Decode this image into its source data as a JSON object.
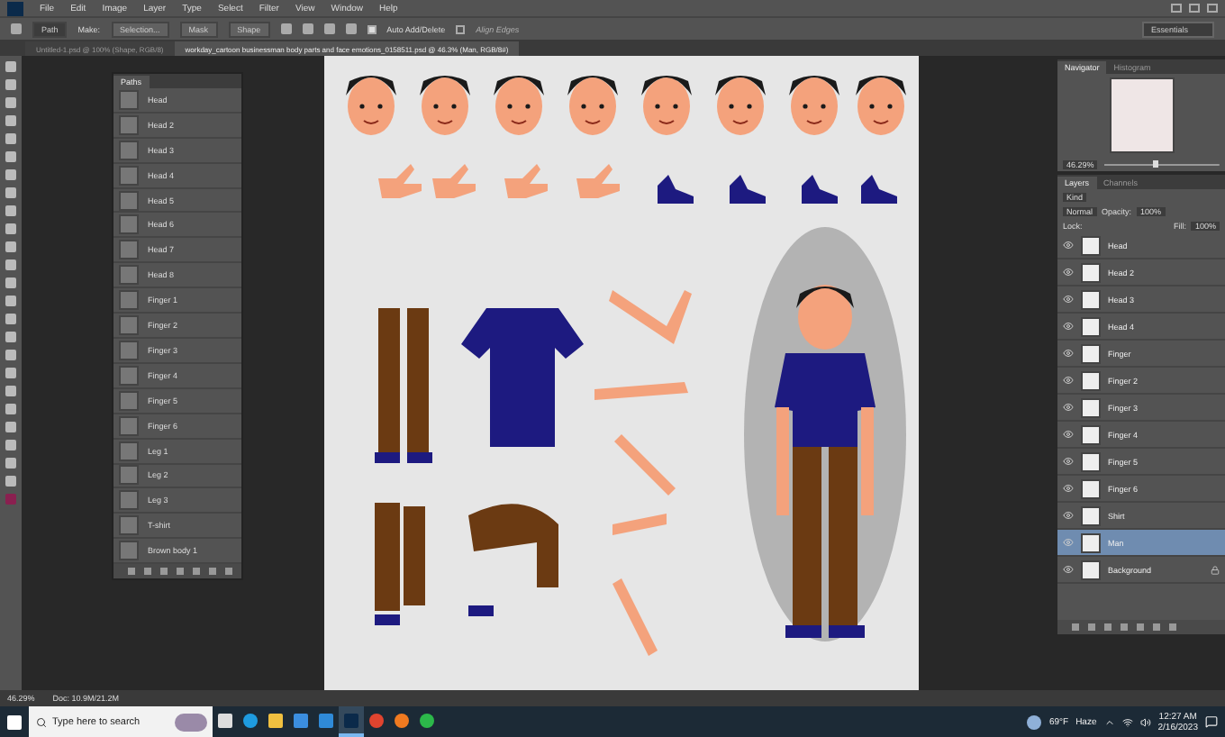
{
  "menu": [
    "File",
    "Edit",
    "Image",
    "Layer",
    "Type",
    "Select",
    "Filter",
    "View",
    "Window",
    "Help"
  ],
  "options": {
    "tool_mode": "Path",
    "make_label": "Make:",
    "buttons": [
      "Selection...",
      "Mask",
      "Shape"
    ],
    "auto_add_delete": {
      "label": "Auto Add/Delete",
      "checked": true
    },
    "align_edges": {
      "label": "Align Edges",
      "checked": false,
      "disabled": true
    },
    "workspace": "Essentials"
  },
  "doc_tabs": [
    {
      "label": "Untitled-1.psd @ 100% (Shape, RGB/8)",
      "selected": false
    },
    {
      "label": "workday_cartoon businessman body parts and face emotions_0158511.psd @ 46.3% (Man, RGB/8#)",
      "selected": true
    }
  ],
  "paths_panel": {
    "title": "Paths",
    "items": [
      "Head",
      "Head 2",
      "Head 3",
      "Head 4",
      "Head 5",
      "Head 6",
      "Head 7",
      "Head 8",
      "Finger 1",
      "Finger 2",
      "Finger 3",
      "Finger 4",
      "Finger 5",
      "Finger 6",
      "Leg 1",
      "Leg 2",
      "Leg 3",
      "T-shirt",
      "Brown body 1"
    ]
  },
  "navigator": {
    "tabs": [
      {
        "label": "Navigator",
        "selected": true
      },
      {
        "label": "Histogram",
        "selected": false
      }
    ],
    "zoom": "46.29%",
    "level": 0.45
  },
  "layers_panel": {
    "tabs": [
      {
        "label": "Layers",
        "selected": true
      },
      {
        "label": "Channels",
        "selected": false
      }
    ],
    "filter": "Kind",
    "blend_mode": "Normal",
    "opacity_label": "Opacity:",
    "opacity": "100%",
    "lock_label": "Lock:",
    "fill_label": "Fill:",
    "fill": "100%",
    "layers": [
      {
        "name": "Head",
        "selected": false,
        "locked": false
      },
      {
        "name": "Head 2",
        "selected": false,
        "locked": false
      },
      {
        "name": "Head 3",
        "selected": false,
        "locked": false
      },
      {
        "name": "Head 4",
        "selected": false,
        "locked": false
      },
      {
        "name": "Finger",
        "selected": false,
        "locked": false
      },
      {
        "name": "Finger 2",
        "selected": false,
        "locked": false
      },
      {
        "name": "Finger 3",
        "selected": false,
        "locked": false
      },
      {
        "name": "Finger 4",
        "selected": false,
        "locked": false
      },
      {
        "name": "Finger 5",
        "selected": false,
        "locked": false
      },
      {
        "name": "Finger 6",
        "selected": false,
        "locked": false
      },
      {
        "name": "Shirt",
        "selected": false,
        "locked": false
      },
      {
        "name": "Man",
        "selected": true,
        "locked": false
      },
      {
        "name": "Background",
        "selected": false,
        "locked": true
      }
    ]
  },
  "status_bar": {
    "zoom": "46.29%",
    "doc": "Doc: 10.9M/21.2M"
  },
  "taskbar": {
    "search_placeholder": "Type here to search",
    "apps": [
      {
        "kind": "taskview",
        "active": false
      },
      {
        "kind": "edge",
        "active": false
      },
      {
        "kind": "folder",
        "active": false
      },
      {
        "kind": "store",
        "active": false
      },
      {
        "kind": "mail",
        "active": false
      },
      {
        "kind": "photoshop",
        "active": true
      },
      {
        "kind": "chrome",
        "active": false
      },
      {
        "kind": "firefox",
        "active": false
      },
      {
        "kind": "green",
        "active": false
      }
    ],
    "temperature": "69°F",
    "weather": "Haze",
    "time": "12:27 AM",
    "date": "2/16/2023"
  }
}
